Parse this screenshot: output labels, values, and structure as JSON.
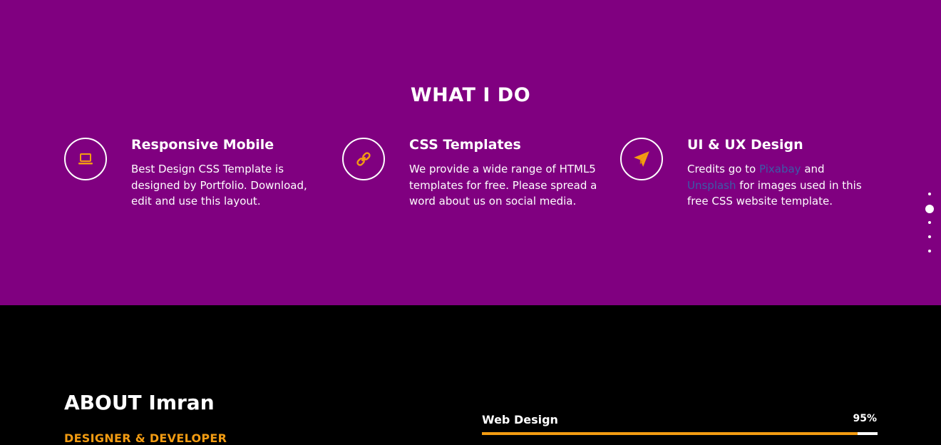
{
  "services": {
    "title": "WHAT I DO",
    "items": [
      {
        "icon": "laptop-icon",
        "title": "Responsive Mobile",
        "desc": "Best Design CSS Template is designed by Portfolio. Download, edit and use this layout."
      },
      {
        "icon": "link-icon",
        "title": "CSS Templates",
        "desc": "We provide a wide range of HTML5 templates for free. Please spread a word about us on social media."
      },
      {
        "icon": "paper-plane-icon",
        "title": "UI & UX Design",
        "desc_prefix": "Credits go to",
        "link1": "Pixabay",
        "desc_and": "and",
        "link2": "Unsplash",
        "desc_suffix": "for images used in this free CSS website template."
      }
    ]
  },
  "nav_dots": {
    "count": 5,
    "active_index": 1
  },
  "about": {
    "title": "ABOUT Imran",
    "subtitle": "DESIGNER & DEVELOPER"
  },
  "skills": [
    {
      "label": "Web Design",
      "percent_label": "95%",
      "percent": 95
    }
  ],
  "colors": {
    "purple_bg": "#800080",
    "dark_bg": "#000000",
    "accent": "#f39c12",
    "link": "#3b5ba8"
  }
}
